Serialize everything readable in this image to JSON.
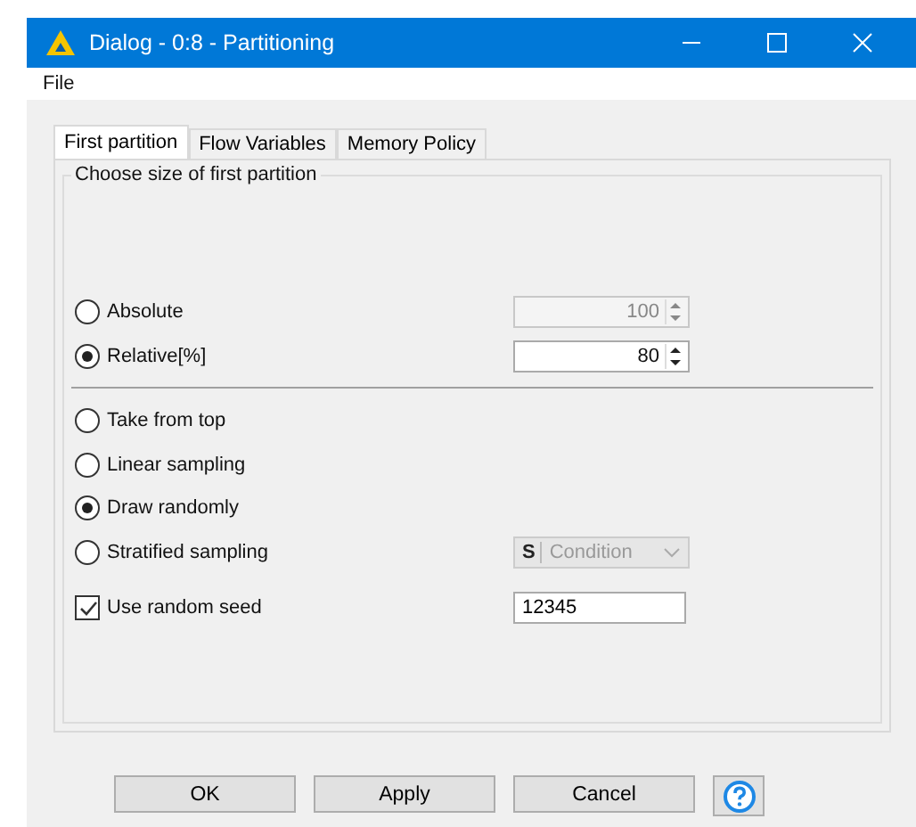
{
  "window": {
    "title": "Dialog - 0:8 - Partitioning"
  },
  "menu": [
    "File"
  ],
  "tabs": [
    {
      "label": "First partition",
      "selected": true
    },
    {
      "label": "Flow Variables",
      "selected": false
    },
    {
      "label": "Memory Policy",
      "selected": false
    }
  ],
  "group": {
    "title": "Choose size of first partition"
  },
  "size_options": [
    {
      "label": "Absolute",
      "selected": false,
      "value": "100",
      "disabled": true
    },
    {
      "label": "Relative[%]",
      "selected": true,
      "value": "80",
      "disabled": false
    }
  ],
  "sampling_options": [
    {
      "kind": "radio",
      "label": "Take from top",
      "selected": false
    },
    {
      "kind": "radio",
      "label": "Linear sampling",
      "selected": false
    },
    {
      "kind": "radio",
      "label": "Draw randomly",
      "selected": true
    },
    {
      "kind": "dropdown",
      "label": "Stratified sampling",
      "selected": false,
      "dropdown": {
        "type_letter": "S",
        "value": "Condition",
        "disabled": true
      }
    }
  ],
  "seed": {
    "label": "Use random seed",
    "checked": true,
    "value": "12345"
  },
  "buttons": [
    {
      "kind": "text",
      "label": "OK"
    },
    {
      "kind": "text",
      "label": "Apply"
    },
    {
      "kind": "text",
      "label": "Cancel"
    },
    {
      "kind": "help"
    }
  ]
}
